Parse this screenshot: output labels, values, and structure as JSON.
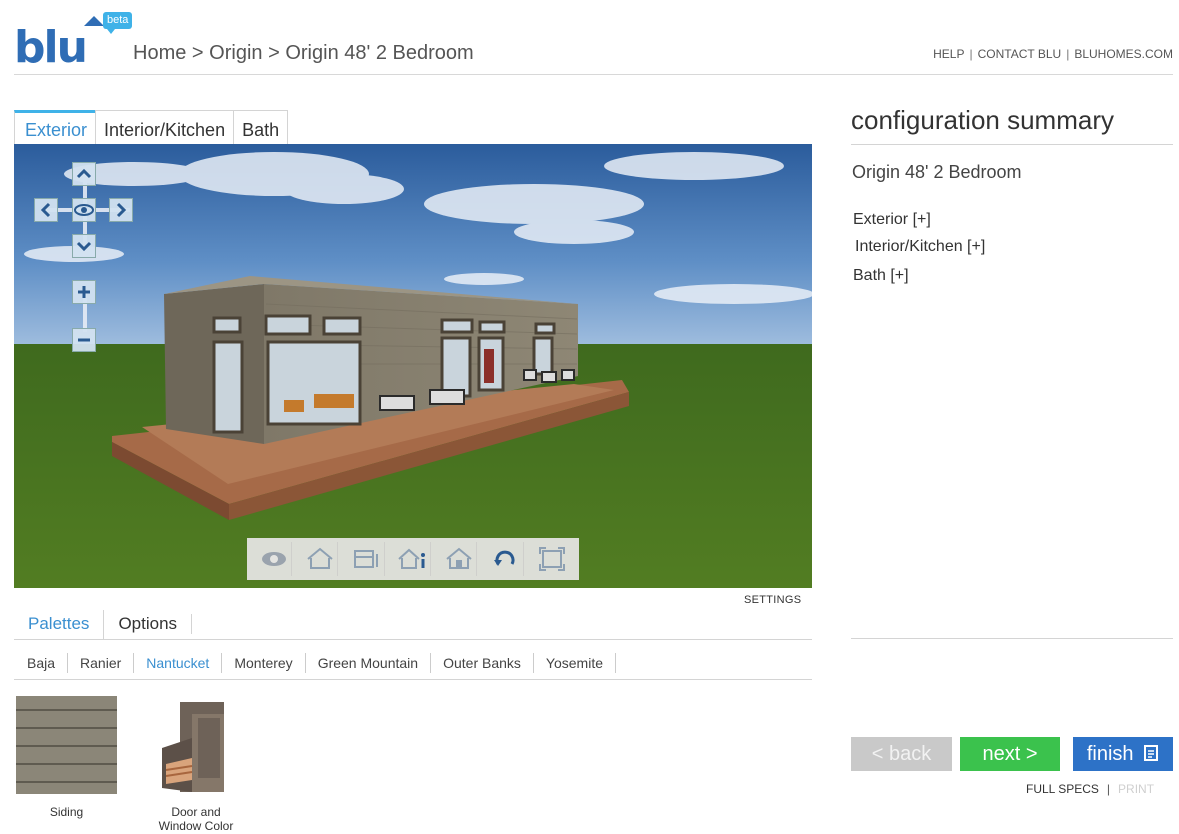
{
  "brand": {
    "logo_text": "blu",
    "badge": "beta"
  },
  "breadcrumb": [
    "Home",
    "Origin",
    "Origin 48' 2 Bedroom"
  ],
  "breadcrumb_separator": ">",
  "top_links": [
    "HELP",
    "CONTACT BLU",
    "BLUHOMES.COM"
  ],
  "view_tabs": [
    {
      "label": "Exterior",
      "active": true
    },
    {
      "label": "Interior/Kitchen",
      "active": false
    },
    {
      "label": "Bath",
      "active": false
    }
  ],
  "viewer": {
    "nav_controls": [
      "chevron-up-icon",
      "chevron-left-icon",
      "eye-icon",
      "chevron-right-icon",
      "chevron-down-icon",
      "zoom-in-icon",
      "zoom-out-icon"
    ],
    "toolbar_icons": [
      "eye-icon",
      "house-outline-icon",
      "floorplan-icon",
      "house-info-icon",
      "house-interior-icon",
      "rotate-icon",
      "fullscreen-icon"
    ],
    "settings_label": "SETTINGS"
  },
  "panel_tabs": [
    {
      "label": "Palettes",
      "active": true
    },
    {
      "label": "Options",
      "active": false
    }
  ],
  "palettes": [
    {
      "label": "Baja",
      "active": false
    },
    {
      "label": "Ranier",
      "active": false
    },
    {
      "label": "Nantucket",
      "active": true
    },
    {
      "label": "Monterey",
      "active": false
    },
    {
      "label": "Green Mountain",
      "active": false
    },
    {
      "label": "Outer Banks",
      "active": false
    },
    {
      "label": "Yosemite",
      "active": false
    }
  ],
  "swatches": [
    {
      "label": "Siding",
      "color": "#8b8678"
    },
    {
      "label_line1": "Door and",
      "label_line2": "Window Color",
      "color": "#6e6258"
    }
  ],
  "summary": {
    "title": "configuration summary",
    "model": "Origin 48' 2 Bedroom",
    "sections": [
      "Exterior [+]",
      "Interior/Kitchen [+]",
      "Bath [+]"
    ]
  },
  "actions": {
    "back": "<  back",
    "next": "next  >",
    "finish": "finish"
  },
  "footer_links": {
    "specs": "FULL SPECS",
    "print": "PRINT"
  },
  "colors": {
    "accent": "#3a8fd0",
    "brand_blue": "#2f6db5",
    "next_green": "#3bc24d",
    "finish_blue": "#2d72c7",
    "disabled_gray": "#c9c9c9"
  }
}
